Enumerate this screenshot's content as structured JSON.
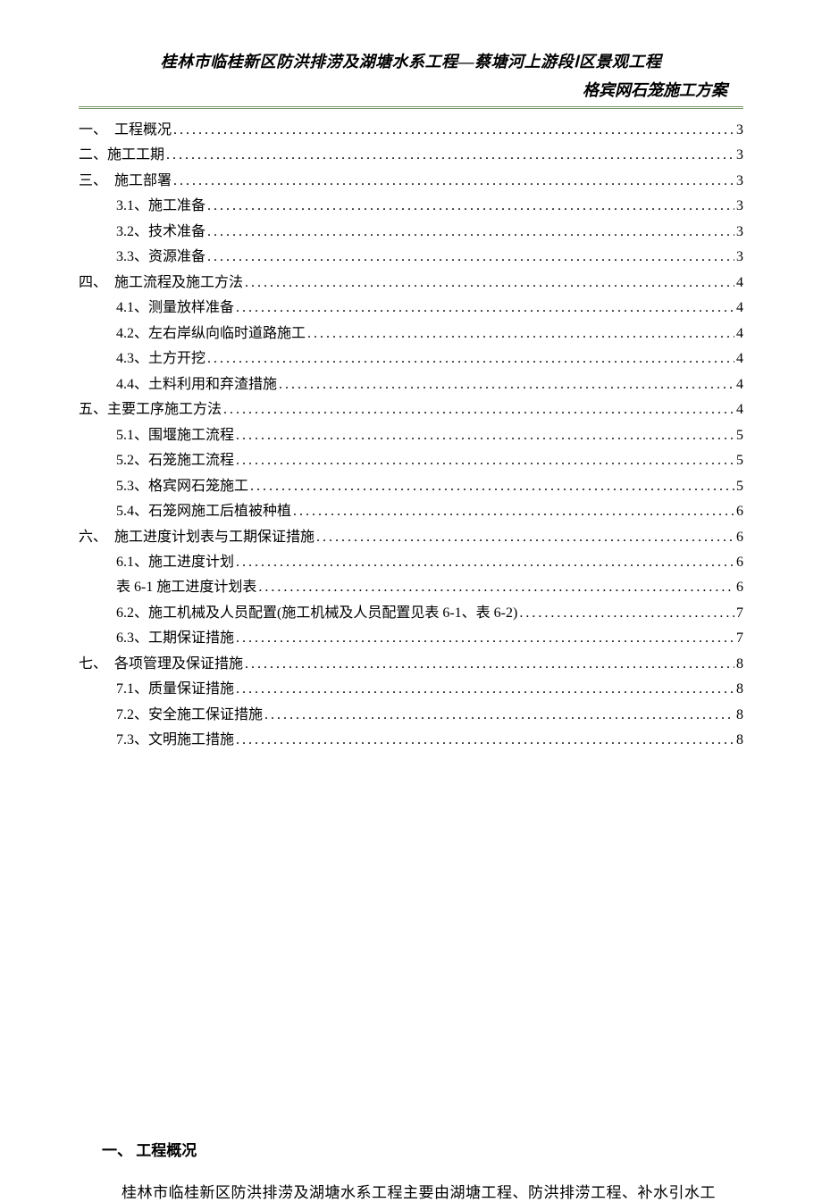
{
  "header": {
    "line1": "桂林市临桂新区防洪排涝及湖塘水系工程—蔡塘河上游段Ⅰ区景观工程",
    "line2": "格宾网石笼施工方案"
  },
  "toc": [
    {
      "level": 1,
      "label": "一、　工程概况",
      "page": "3"
    },
    {
      "level": 1,
      "label": "二、施工工期",
      "page": "3"
    },
    {
      "level": 1,
      "label": "三、　施工部署",
      "page": "3"
    },
    {
      "level": 2,
      "label": "3.1、施工准备 ",
      "page": "3"
    },
    {
      "level": 2,
      "label": "3.2、技术准备 ",
      "page": "3"
    },
    {
      "level": 2,
      "label": "3.3、资源准备 ",
      "page": "3"
    },
    {
      "level": 1,
      "label": "四、　施工流程及施工方法",
      "page": "4"
    },
    {
      "level": 2,
      "label": "4.1、测量放样准备 ",
      "page": "4"
    },
    {
      "level": 2,
      "label": "4.2、左右岸纵向临时道路施工 ",
      "page": "4"
    },
    {
      "level": 2,
      "label": "4.3、土方开挖 ",
      "page": "4"
    },
    {
      "level": 2,
      "label": "4.4、土料利用和弃渣措施 ",
      "page": "4"
    },
    {
      "level": 1,
      "label": "五、主要工序施工方法",
      "page": "4"
    },
    {
      "level": 2,
      "label": "5.1、围堰施工流程 ",
      "page": "5"
    },
    {
      "level": 2,
      "label": "5.2、石笼施工流程 ",
      "page": "5"
    },
    {
      "level": 2,
      "label": "5.3、格宾网石笼施工 ",
      "page": "5"
    },
    {
      "level": 2,
      "label": "5.4、石笼网施工后植被种植 ",
      "page": "6"
    },
    {
      "level": 1,
      "label": "六、　施工进度计划表与工期保证措施",
      "page": "6"
    },
    {
      "level": 2,
      "label": "6.1、施工进度计划 ",
      "page": "6"
    },
    {
      "level": 2,
      "label": "表 6-1 施工进度计划表",
      "page": "6"
    },
    {
      "level": 2,
      "label": "6.2、施工机械及人员配置(施工机械及人员配置见表 6-1、表 6-2) ",
      "page": "7"
    },
    {
      "level": 2,
      "label": "6.3、工期保证措施 ",
      "page": "7"
    },
    {
      "level": 1,
      "label": "七、　各项管理及保证措施",
      "page": "8"
    },
    {
      "level": 2,
      "label": "7.1、质量保证措施 ",
      "page": "8"
    },
    {
      "level": 2,
      "label": "7.2、安全施工保证措施 ",
      "page": "8"
    },
    {
      "level": 2,
      "label": "7.3、文明施工措施 ",
      "page": "8"
    }
  ],
  "section": {
    "heading": "一、 工程概况",
    "paragraph": "桂林市临桂新区防洪排涝及湖塘水系工程主要由湖塘工程、防洪排涝工程、补水引水工"
  }
}
